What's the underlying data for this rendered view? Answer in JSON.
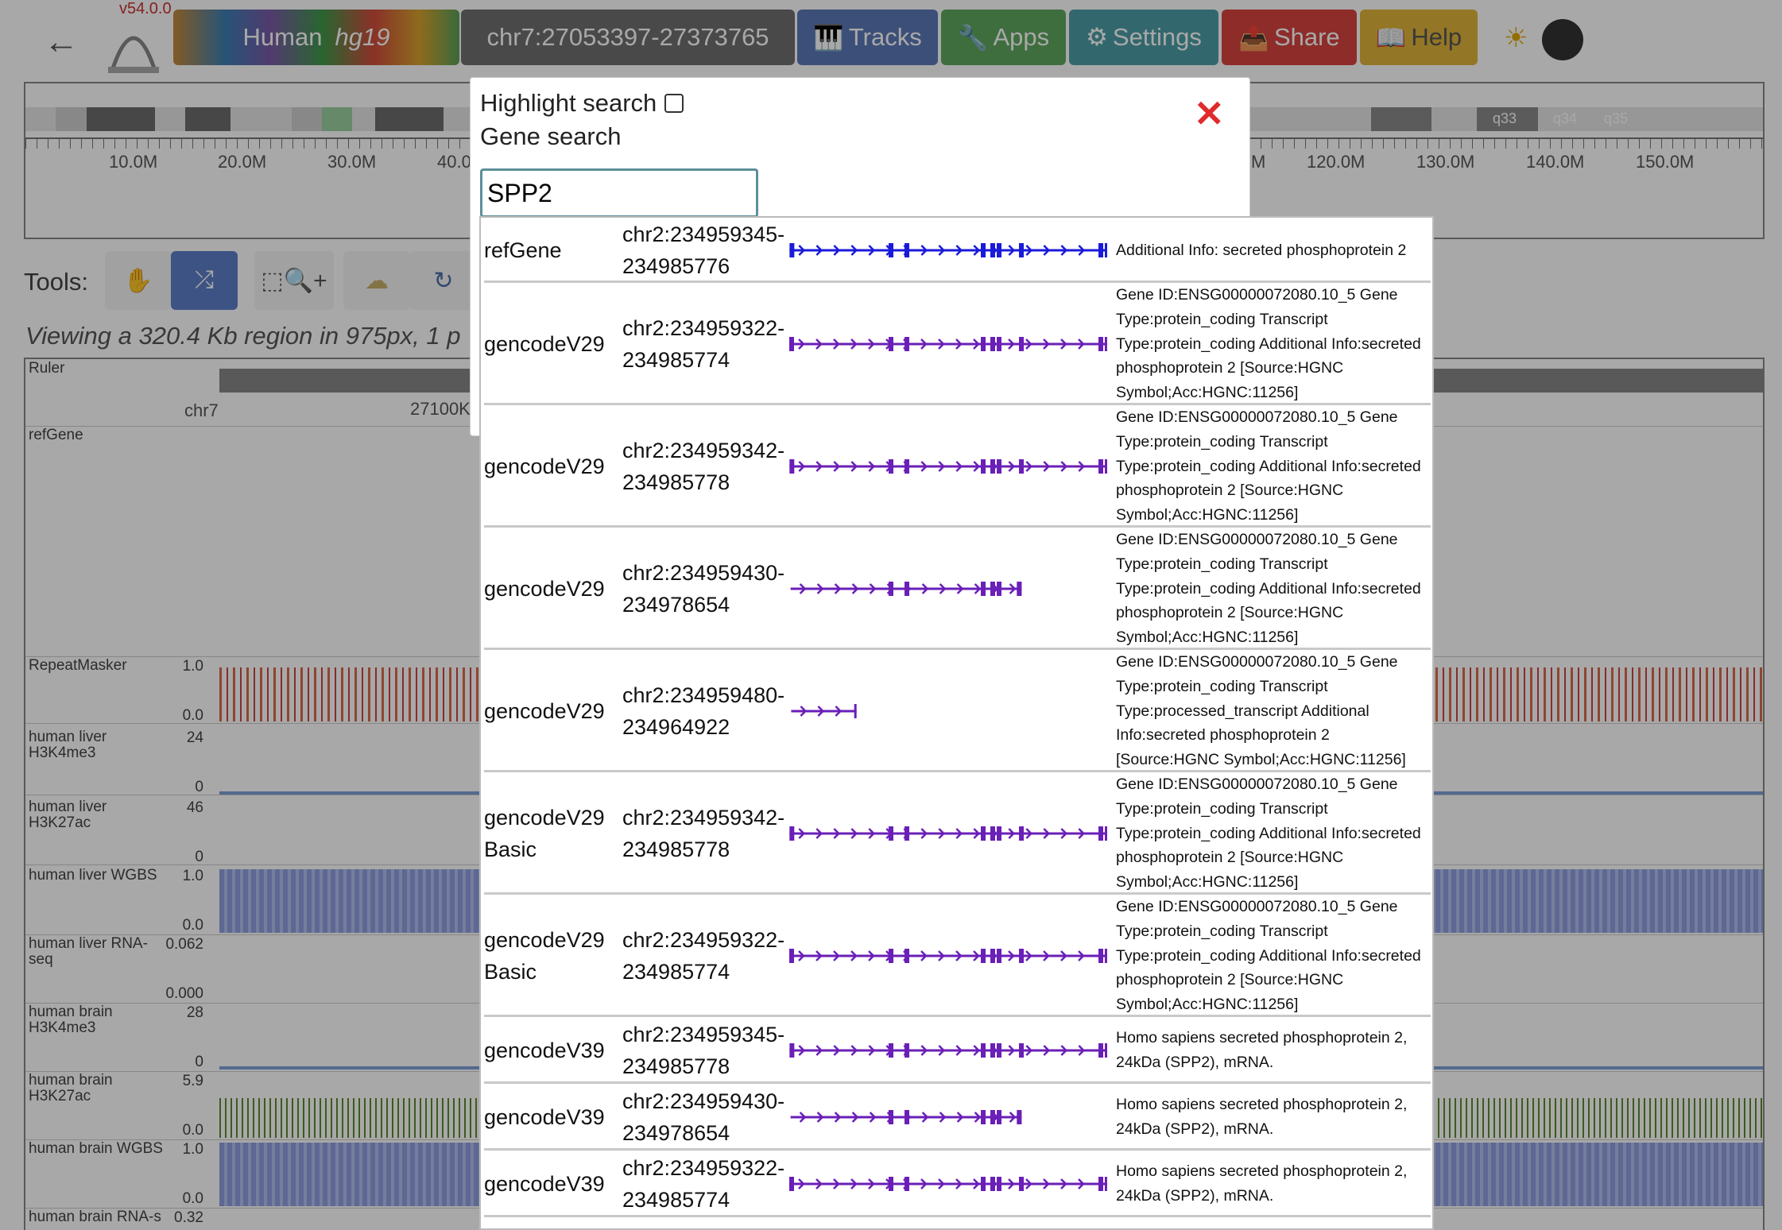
{
  "app": {
    "version": "v54.0.0",
    "genome": {
      "species": "Human",
      "assembly": "hg19"
    },
    "locus": "chr7:27053397-27373765",
    "menu": [
      {
        "icon": "piano-icon",
        "glyph": "🎹",
        "label": "Tracks"
      },
      {
        "icon": "wrench-icon",
        "glyph": "🔧",
        "label": "Apps"
      },
      {
        "icon": "gear-icon",
        "glyph": "⚙",
        "label": "Settings"
      },
      {
        "icon": "share-icon",
        "glyph": "📤",
        "label": "Share"
      },
      {
        "icon": "book-icon",
        "glyph": "📖",
        "label": "Help"
      }
    ]
  },
  "navigator": {
    "ticks": [
      "10.0M",
      "20.0M",
      "30.0M",
      "40.0",
      "M",
      "120.0M",
      "130.0M",
      "140.0M",
      "150.0M"
    ],
    "bands": [
      "q33",
      "q34",
      "q35"
    ]
  },
  "tools": {
    "label": "Tools:",
    "viewing": "Viewing a 320.4 Kb region in 975px, 1 p"
  },
  "tracks": {
    "ruler": {
      "label": "Ruler",
      "chrom": "chr7",
      "pos": "27100K"
    },
    "items": [
      {
        "label": "refGene",
        "max": "",
        "min": ""
      },
      {
        "label": "RepeatMasker",
        "max": "1.0",
        "min": "0.0"
      },
      {
        "label": "human liver H3K4me3",
        "max": "24",
        "min": "0"
      },
      {
        "label": "human liver H3K27ac",
        "max": "46",
        "min": "0"
      },
      {
        "label": "human liver WGBS",
        "max": "1.0",
        "min": "0.0"
      },
      {
        "label": "human liver RNA-seq",
        "max": "0.062",
        "min": "0.000"
      },
      {
        "label": "human brain H3K4me3",
        "max": "28",
        "min": "0"
      },
      {
        "label": "human brain H3K27ac",
        "max": "5.9",
        "min": "0.0"
      },
      {
        "label": "human brain WGBS",
        "max": "1.0",
        "min": "0.0"
      },
      {
        "label": "human brain RNA-s",
        "max": "0.32",
        "min": ""
      }
    ]
  },
  "modal": {
    "highlight_label": "Highlight search",
    "highlight_checked": false,
    "gene_search_label": "Gene search",
    "search_value": "SPP2"
  },
  "results": [
    {
      "source": "refGene",
      "coord1": "chr2:234959345-",
      "coord2": "234985776",
      "color": "#1a1ad9",
      "info": "Additional Info: secreted phosphoprotein 2"
    },
    {
      "source": "gencodeV29",
      "coord1": "chr2:234959322-",
      "coord2": "234985774",
      "color": "#6a1fb8",
      "info": "Gene ID:ENSG00000072080.10_5 Gene Type:protein_coding Transcript Type:protein_coding Additional Info:secreted phosphoprotein 2 [Source:HGNC Symbol;Acc:HGNC:11256]"
    },
    {
      "source": "gencodeV29",
      "coord1": "chr2:234959342-",
      "coord2": "234985778",
      "color": "#6a1fb8",
      "info": "Gene ID:ENSG00000072080.10_5 Gene Type:protein_coding Transcript Type:protein_coding Additional Info:secreted phosphoprotein 2 [Source:HGNC Symbol;Acc:HGNC:11256]"
    },
    {
      "source": "gencodeV29",
      "coord1": "chr2:234959430-",
      "coord2": "234978654",
      "color": "#6a1fb8",
      "info": "Gene ID:ENSG00000072080.10_5 Gene Type:protein_coding Transcript Type:protein_coding Additional Info:secreted phosphoprotein 2 [Source:HGNC Symbol;Acc:HGNC:11256]"
    },
    {
      "source": "gencodeV29",
      "coord1": "chr2:234959480-",
      "coord2": "234964922",
      "color": "#6a1fb8",
      "info": "Gene ID:ENSG00000072080.10_5 Gene Type:protein_coding Transcript Type:processed_transcript Additional Info:secreted phosphoprotein 2 [Source:HGNC Symbol;Acc:HGNC:11256]"
    },
    {
      "source": "gencodeV29 Basic",
      "coord1": "chr2:234959342-",
      "coord2": "234985778",
      "color": "#6a1fb8",
      "info": "Gene ID:ENSG00000072080.10_5 Gene Type:protein_coding Transcript Type:protein_coding Additional Info:secreted phosphoprotein 2 [Source:HGNC Symbol;Acc:HGNC:11256]"
    },
    {
      "source": "gencodeV29 Basic",
      "coord1": "chr2:234959322-",
      "coord2": "234985774",
      "color": "#6a1fb8",
      "info": "Gene ID:ENSG00000072080.10_5 Gene Type:protein_coding Transcript Type:protein_coding Additional Info:secreted phosphoprotein 2 [Source:HGNC Symbol;Acc:HGNC:11256]"
    },
    {
      "source": "gencodeV39",
      "coord1": "chr2:234959345-",
      "coord2": "234985778",
      "color": "#6a1fb8",
      "info": "Homo sapiens secreted phosphoprotein 2, 24kDa (SPP2), mRNA."
    },
    {
      "source": "gencodeV39",
      "coord1": "chr2:234959430-",
      "coord2": "234978654",
      "color": "#6a1fb8",
      "info": "Homo sapiens secreted phosphoprotein 2, 24kDa (SPP2), mRNA."
    },
    {
      "source": "gencodeV39",
      "coord1": "chr2:234959322-",
      "coord2": "234985774",
      "color": "#6a1fb8",
      "info": "Homo sapiens secreted phosphoprotein 2, 24kDa (SPP2), mRNA."
    }
  ]
}
